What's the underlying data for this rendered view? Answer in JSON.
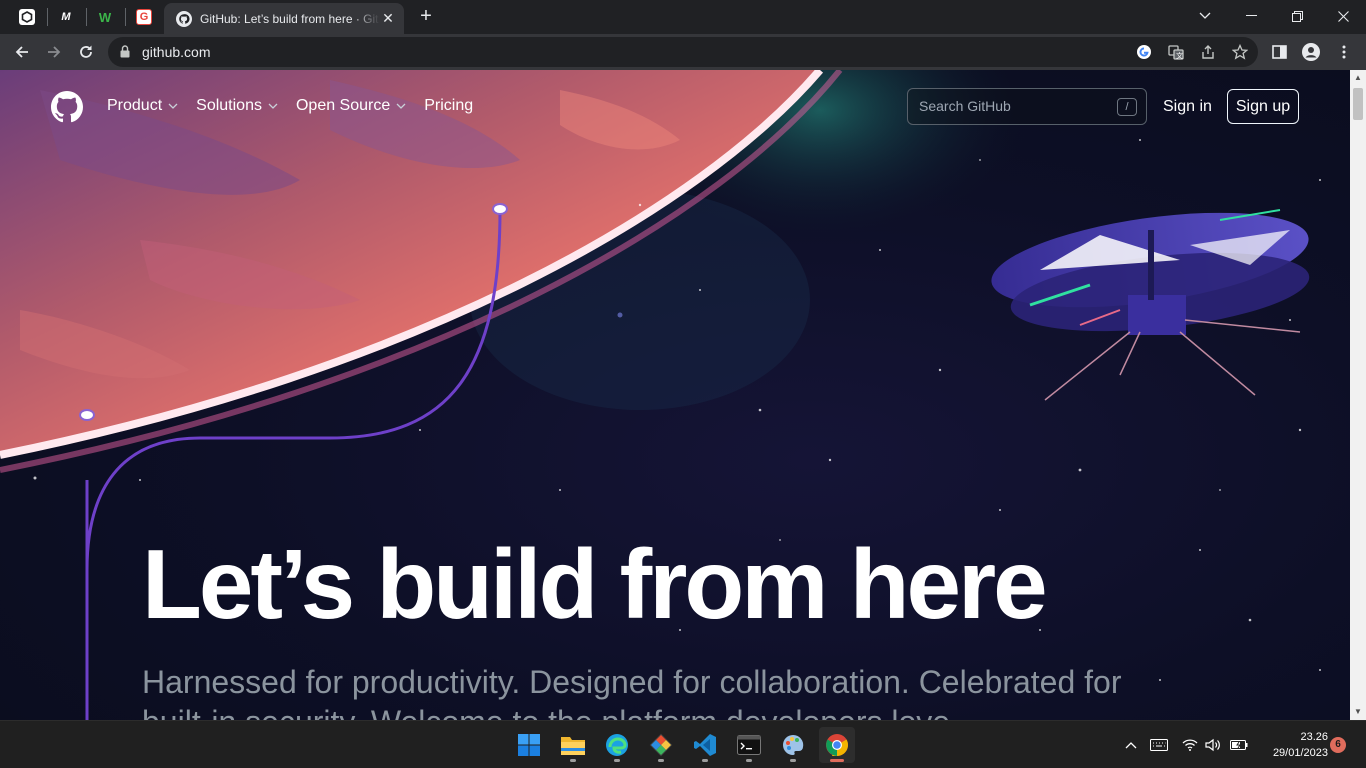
{
  "browser": {
    "pinned_tabs": [
      {
        "name": "pinned-tab-1",
        "glyph": "⬡",
        "bg": "#ffffff",
        "fg": "#202124"
      },
      {
        "name": "pinned-tab-2",
        "glyph": "M",
        "bg": "#202124",
        "fg": "#ffffff"
      },
      {
        "name": "pinned-tab-3",
        "glyph": "W",
        "bg": "#202124",
        "fg": "#3bb54a"
      },
      {
        "name": "pinned-tab-4",
        "glyph": "G",
        "bg": "#ffffff",
        "fg": "#e8453c"
      }
    ],
    "active_tab_title": "GitHub: Let’s build from here · GitHub",
    "url": "github.com",
    "controls": {
      "close_tab": "✕",
      "new_tab": "+",
      "minimize": "—",
      "maximize": "❐",
      "chevron": "⌄",
      "close_window": "✕"
    }
  },
  "github": {
    "nav": [
      {
        "label": "Product",
        "dropdown": true
      },
      {
        "label": "Solutions",
        "dropdown": true
      },
      {
        "label": "Open Source",
        "dropdown": true
      },
      {
        "label": "Pricing",
        "dropdown": false
      }
    ],
    "search_placeholder": "Search GitHub",
    "search_shortcut": "/",
    "sign_in": "Sign in",
    "sign_up": "Sign up",
    "hero_title": "Let’s build from here",
    "hero_subtitle": "Harnessed for productivity. Designed for collaboration. Celebrated for built-in security. Welcome to the platform developers love."
  },
  "taskbar": {
    "apps": [
      "windows-start-icon",
      "file-explorer-icon",
      "edge-icon",
      "git-icon",
      "vscode-icon",
      "terminal-icon",
      "paint-icon",
      "chrome-icon"
    ],
    "time": "23.26",
    "date": "29/01/2023",
    "notification_count": "6"
  },
  "colors": {
    "github_bg": "#0d1117",
    "signup_border": "#f0f6fc",
    "accent_line": "#6e40c9"
  }
}
